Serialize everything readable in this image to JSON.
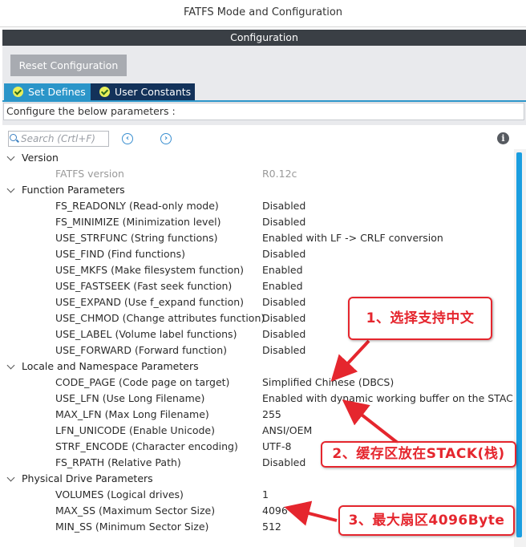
{
  "window": {
    "title": "FATFS Mode and Configuration"
  },
  "config_header": "Configuration",
  "reset_button": "Reset Configuration",
  "tabs": [
    {
      "label": "Set Defines",
      "active": true
    },
    {
      "label": "User Constants",
      "active": false
    }
  ],
  "caption": "Configure the below parameters :",
  "search": {
    "placeholder": "Search (Crtl+F)"
  },
  "nav": {
    "prev": "‹",
    "next": "›"
  },
  "info": "i",
  "groups": [
    {
      "label": "Version",
      "params": [
        {
          "name": "FATFS version",
          "value": "R0.12c",
          "readonly": true
        }
      ]
    },
    {
      "label": "Function Parameters",
      "params": [
        {
          "name": "FS_READONLY (Read-only mode)",
          "value": "Disabled"
        },
        {
          "name": "FS_MINIMIZE (Minimization level)",
          "value": "Disabled"
        },
        {
          "name": "USE_STRFUNC (String functions)",
          "value": "Enabled with LF -> CRLF conversion"
        },
        {
          "name": "USE_FIND (Find functions)",
          "value": "Disabled"
        },
        {
          "name": "USE_MKFS (Make filesystem function)",
          "value": "Enabled"
        },
        {
          "name": "USE_FASTSEEK (Fast seek function)",
          "value": "Enabled"
        },
        {
          "name": "USE_EXPAND (Use f_expand function)",
          "value": "Disabled"
        },
        {
          "name": "USE_CHMOD (Change attributes function)",
          "value": "Disabled"
        },
        {
          "name": "USE_LABEL (Volume label functions)",
          "value": "Disabled"
        },
        {
          "name": "USE_FORWARD (Forward function)",
          "value": "Disabled"
        }
      ]
    },
    {
      "label": "Locale and Namespace Parameters",
      "params": [
        {
          "name": "CODE_PAGE (Code page on target)",
          "value": "Simplified Chinese (DBCS)"
        },
        {
          "name": "USE_LFN (Use Long Filename)",
          "value": "Enabled with dynamic working buffer on the STACK"
        },
        {
          "name": "MAX_LFN (Max Long Filename)",
          "value": "255"
        },
        {
          "name": "LFN_UNICODE (Enable Unicode)",
          "value": "ANSI/OEM"
        },
        {
          "name": "STRF_ENCODE (Character encoding)",
          "value": "UTF-8"
        },
        {
          "name": "FS_RPATH (Relative Path)",
          "value": "Disabled"
        }
      ]
    },
    {
      "label": "Physical Drive Parameters",
      "params": [
        {
          "name": "VOLUMES (Logical drives)",
          "value": "1"
        },
        {
          "name": "MAX_SS (Maximum Sector Size)",
          "value": "4096"
        },
        {
          "name": "MIN_SS (Minimum Sector Size)",
          "value": "512"
        }
      ]
    }
  ],
  "annotations": [
    {
      "text": "1、选择支持中文"
    },
    {
      "text": "2、缓存区放在STACK(栈)"
    },
    {
      "text": "3、最大扇区4096Byte"
    }
  ],
  "colors": {
    "tab_active": "#2b95c9",
    "tab_inactive": "#13325a",
    "header": "#3a3f45",
    "annotation": "#e5262e",
    "scrollbar": "#1a9ee0"
  }
}
